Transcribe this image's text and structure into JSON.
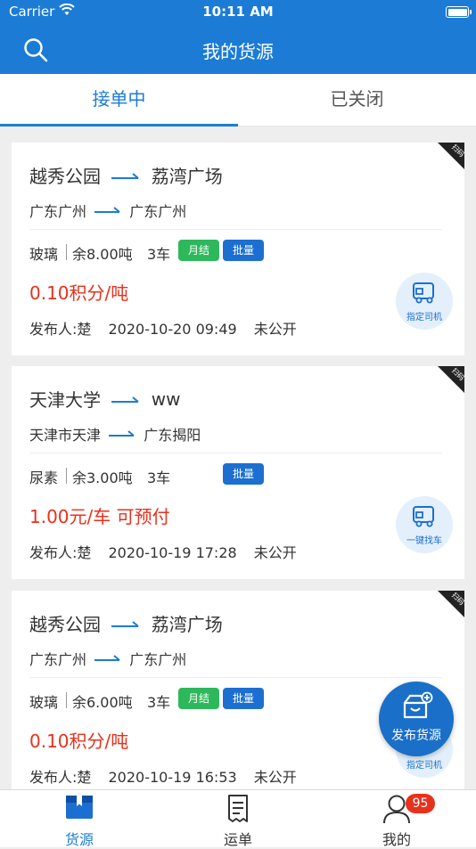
{
  "status_bar": {
    "carrier": "Carrier",
    "time": "10:11 AM"
  },
  "nav": {
    "title": "我的货源"
  },
  "tabs": [
    {
      "label": "接单中",
      "active": true
    },
    {
      "label": "已关闭",
      "active": false
    }
  ],
  "corner_tag": "扫码",
  "cards": [
    {
      "from": "越秀公园",
      "to": "荔湾广场",
      "from_city": "广东广州",
      "to_city": "广东广州",
      "cargo": "玻璃",
      "remaining": "余8.00吨",
      "trucks": "3车",
      "badge_monthly": "月结",
      "badge_batch": "批量",
      "price": "0.10积分/吨",
      "publisher": "发布人:楚",
      "datetime": "2020-10-20 09:49",
      "visibility": "未公开",
      "action_label": "指定司机"
    },
    {
      "from": "天津大学",
      "to": "ww",
      "from_city": "天津市天津",
      "to_city": "广东揭阳",
      "cargo": "尿素",
      "remaining": "余3.00吨",
      "trucks": "3车",
      "badge_batch": "批量",
      "price": "1.00元/车 可预付",
      "publisher": "发布人:楚",
      "datetime": "2020-10-19 17:28",
      "visibility": "未公开",
      "action_label": "一键找车"
    },
    {
      "from": "越秀公园",
      "to": "荔湾广场",
      "from_city": "广东广州",
      "to_city": "广东广州",
      "cargo": "玻璃",
      "remaining": "余6.00吨",
      "trucks": "3车",
      "badge_monthly": "月结",
      "badge_batch": "批量",
      "price": "0.10积分/吨",
      "publisher": "发布人:楚",
      "datetime": "2020-10-19 16:53",
      "visibility": "未公开",
      "action_label": "指定司机"
    }
  ],
  "fab": {
    "label": "发布货源"
  },
  "tabbar": {
    "items": [
      {
        "label": "货源",
        "active": true
      },
      {
        "label": "运单",
        "active": false
      },
      {
        "label": "我的",
        "active": false
      }
    ],
    "badge_count": "95"
  },
  "colors": {
    "primary": "#1c7cd5",
    "price": "#e8311c",
    "badge_green": "#2eb85c",
    "badge_blue": "#1c6fd0"
  }
}
